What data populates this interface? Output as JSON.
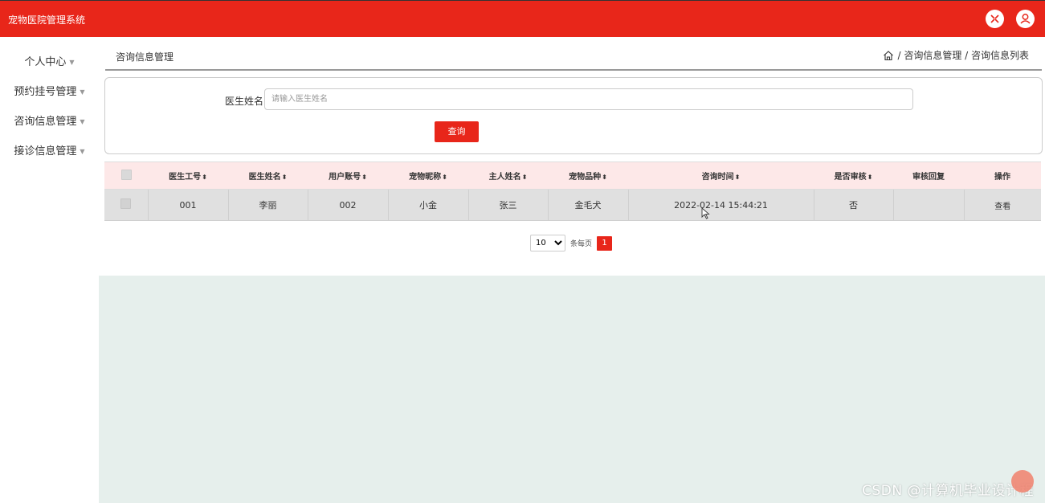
{
  "app": {
    "title": "宠物医院管理系统"
  },
  "header": {
    "fullscreen_icon": "expand-icon",
    "user_icon": "user-icon"
  },
  "sidebar": {
    "items": [
      {
        "label": "个人中心"
      },
      {
        "label": "预约挂号管理"
      },
      {
        "label": "咨询信息管理"
      },
      {
        "label": "接诊信息管理"
      }
    ]
  },
  "breadcrumb": {
    "page_title": "咨询信息管理",
    "path": "/ 咨询信息管理 / 咨询信息列表"
  },
  "search": {
    "label": "医生姓名",
    "placeholder": "请输入医生姓名",
    "button_label": "查询"
  },
  "table": {
    "headers": [
      "医生工号",
      "医生姓名",
      "用户账号",
      "宠物昵称",
      "主人姓名",
      "宠物品种",
      "咨询时间",
      "是否审核",
      "审核回复",
      "操作"
    ],
    "rows": [
      {
        "doctor_id": "001",
        "doctor_name": "李丽",
        "user_account": "002",
        "pet_name": "小金",
        "owner_name": "张三",
        "pet_breed": "金毛犬",
        "consult_time": "2022-02-14 15:44:21",
        "reviewed": "否",
        "reply": "",
        "action": "查看"
      }
    ]
  },
  "pagination": {
    "page_size": "10",
    "per_page_text": "条每页",
    "current_page": "1"
  },
  "watermark": "CSDN @计算机毕业设计程",
  "colors": {
    "primary": "#e8261a",
    "header_row": "#fde8e8",
    "bottom_area": "#e6efec"
  }
}
